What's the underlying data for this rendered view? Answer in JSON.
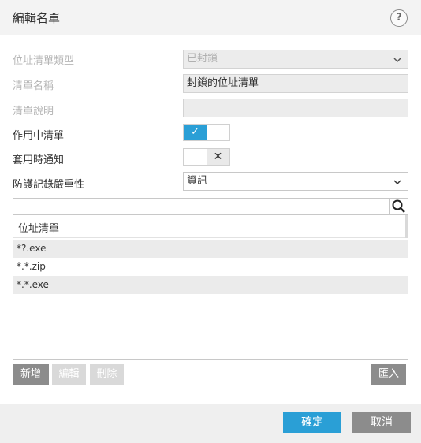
{
  "dialog": {
    "title": "編輯名單",
    "help_icon": "?"
  },
  "form": {
    "list_type": {
      "label": "位址清單類型",
      "value": "已封鎖"
    },
    "list_name": {
      "label": "清單名稱",
      "value": "封鎖的位址清單"
    },
    "list_description": {
      "label": "清單說明",
      "value": ""
    },
    "active_list": {
      "label": "作用中清單",
      "state": "on",
      "on_glyph": "✓"
    },
    "notify_on_apply": {
      "label": "套用時通知",
      "state": "off",
      "off_glyph": "✕"
    },
    "log_severity": {
      "label": "防護記錄嚴重性",
      "value": "資訊"
    }
  },
  "address_list": {
    "header": "位址清單",
    "rows": [
      "*?.exe",
      "*.*.zip",
      "*.*.exe"
    ]
  },
  "list_buttons": {
    "add": "新增",
    "edit": "編輯",
    "delete": "刪除",
    "import": "匯入"
  },
  "footer": {
    "ok": "確定",
    "cancel": "取消"
  },
  "colors": {
    "accent": "#2a9fd6",
    "button_gray": "#8c8c8c",
    "disabled_gray": "#d9d9d9"
  }
}
